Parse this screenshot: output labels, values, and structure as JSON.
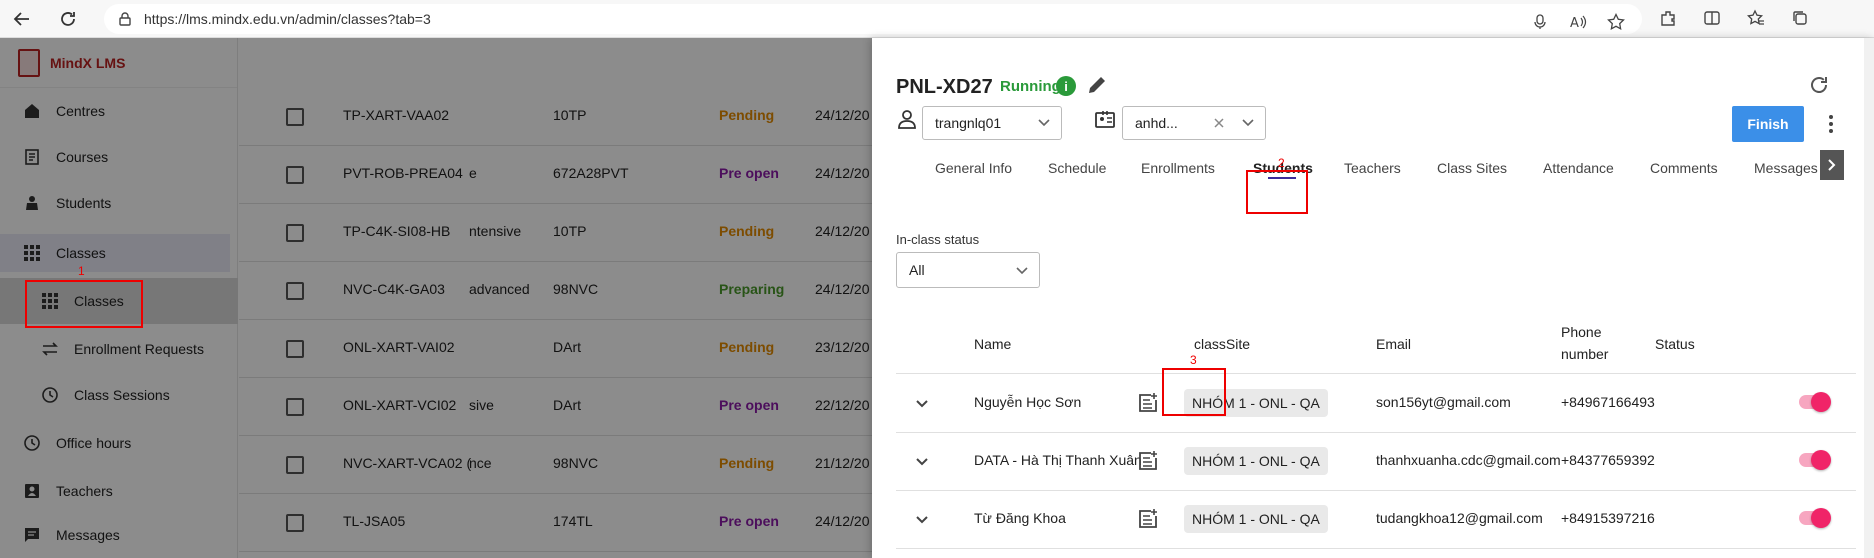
{
  "browser": {
    "url": "https://lms.mindx.edu.vn/admin/classes?tab=3"
  },
  "sidebar": {
    "logo_text": "MindX LMS",
    "items": [
      {
        "label": "Centres"
      },
      {
        "label": "Courses"
      },
      {
        "label": "Students"
      },
      {
        "label": "Classes"
      },
      {
        "label": "Classes"
      },
      {
        "label": "Enrollment Requests"
      },
      {
        "label": "Class Sessions"
      },
      {
        "label": "Office hours"
      },
      {
        "label": "Teachers"
      },
      {
        "label": "Messages"
      }
    ]
  },
  "background_table": {
    "rows": [
      {
        "code": "TP-XART-VAA02",
        "extra": "",
        "centre": "10TP",
        "status": "Pending",
        "date": "24/12/20"
      },
      {
        "code": "PVT-ROB-PREA04",
        "extra": "e",
        "centre": "672A28PVT",
        "status": "Pre open",
        "date": "24/12/20"
      },
      {
        "code": "TP-C4K-SI08-HB",
        "extra": "ntensive",
        "centre": "10TP",
        "status": "Pending",
        "date": "24/12/20"
      },
      {
        "code": "NVC-C4K-GA03",
        "extra": " advanced",
        "centre": "98NVC",
        "status": "Preparing",
        "date": "24/12/20"
      },
      {
        "code": "ONL-XART-VAI02",
        "extra": "",
        "centre": "DArt",
        "status": "Pending",
        "date": "23/12/20"
      },
      {
        "code": "ONL-XART-VCI02",
        "extra": "sive",
        "centre": "DArt",
        "status": "Pre open",
        "date": "22/12/20"
      },
      {
        "code": "NVC-XART-VCA02 (",
        "extra": "nce",
        "centre": "98NVC",
        "status": "Pending",
        "date": "21/12/20"
      },
      {
        "code": "TL-JSA05",
        "extra": "",
        "centre": "174TL",
        "status": "Pre open",
        "date": "24/12/20"
      }
    ]
  },
  "panel": {
    "title": "PNL-XD27",
    "status": "Running",
    "info_symbol": "i",
    "teacher_select": "trangnlq01",
    "assistant_select": "anhd...",
    "finish_label": "Finish",
    "tabs": [
      "General Info",
      "Schedule",
      "Enrollments",
      "Students",
      "Teachers",
      "Class Sites",
      "Attendance",
      "Comments",
      "Messages"
    ],
    "in_class_status_label": "In-class status",
    "in_class_status_value": "All",
    "columns": {
      "name": "Name",
      "classsite": "classSite",
      "email": "Email",
      "phone_l1": "Phone",
      "phone_l2": "number",
      "status": "Status"
    },
    "students": [
      {
        "name": "Nguyễn Học Sơn",
        "classsite": "NHÓM 1 - ONL - QA",
        "email": "son156yt@gmail.com",
        "phone": "+84967166493"
      },
      {
        "name": "DATA - Hà Thị Thanh Xuân",
        "classsite": "NHÓM 1 - ONL - QA",
        "email": "thanhxuanha.cdc@gmail.com",
        "phone": "+84377659392"
      },
      {
        "name": "Từ Đăng Khoa",
        "classsite": "NHÓM 1 - ONL - QA",
        "email": "tudangkhoa12@gmail.com",
        "phone": "+84915397216"
      }
    ]
  },
  "annotations": {
    "n1": "1",
    "n2": "2",
    "n3": "3"
  },
  "colors": {
    "accent": "#3b8fe8",
    "running": "#2a9a3a",
    "toggle": "#f02468",
    "annotation": "#ee0000"
  }
}
